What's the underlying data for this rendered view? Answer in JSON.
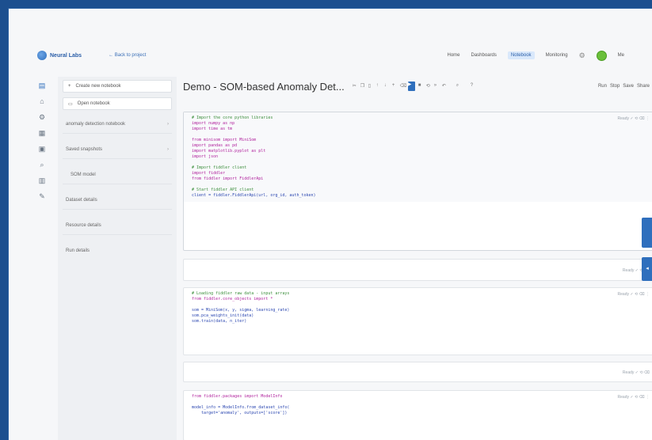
{
  "header": {
    "brand": "Neural Labs",
    "back_link": "← Back to project",
    "nav": [
      "Home",
      "Dashboards",
      "Notebook",
      "Monitoring"
    ],
    "active_nav": "Notebook",
    "settings_icon": "gear-icon",
    "user_initials": "Me"
  },
  "sidebar": {
    "buttons": [
      "Create new notebook",
      "Open notebook"
    ],
    "sections": [
      {
        "label": "anomaly detection notebook",
        "chevron": "›"
      },
      {
        "label": "Saved snapshots",
        "chevron": "›"
      },
      {
        "label": "SOM model",
        "chevron": ""
      },
      {
        "label": "Dataset details",
        "chevron": ""
      },
      {
        "label": "Resource details",
        "chevron": ""
      },
      {
        "label": "Run details",
        "chevron": ""
      }
    ]
  },
  "notebook": {
    "title": "Demo - SOM-based Anomaly Det...",
    "toolbar_right": [
      "Run",
      "Stop",
      "Save",
      "Share"
    ]
  },
  "cells": [
    {
      "meta": "Ready ✓ ⟲ ⌫ ⋮",
      "lines": [
        {
          "t": "cm",
          "v": "# Import the core python libraries"
        },
        {
          "t": "kw",
          "v": "import numpy as np"
        },
        {
          "t": "kw",
          "v": "import time as tm"
        },
        {
          "t": "gap",
          "v": ""
        },
        {
          "t": "kw",
          "v": "from minisom import MiniSom"
        },
        {
          "t": "kw",
          "v": "import pandas as pd"
        },
        {
          "t": "kw",
          "v": "import matplotlib.pyplot as plt"
        },
        {
          "t": "kw",
          "v": "import json"
        },
        {
          "t": "gap",
          "v": ""
        },
        {
          "t": "cm",
          "v": "# Import fiddler client"
        },
        {
          "t": "kw",
          "v": "import fiddler"
        },
        {
          "t": "kw",
          "v": "from fiddler import FiddlerApi"
        },
        {
          "t": "gap",
          "v": ""
        },
        {
          "t": "cm",
          "v": "# Start fiddler API client"
        },
        {
          "t": "str",
          "v": "client = fiddler.FiddlerApi(url, org_id, auth_token)"
        }
      ]
    },
    {
      "meta": "Ready ✓ ⟲ ⌫",
      "lines": []
    },
    {
      "meta": "Ready ✓ ⟲ ⌫ ⋮",
      "lines": [
        {
          "t": "cm",
          "v": "# Loading fiddler raw data - input arrays"
        },
        {
          "t": "kw",
          "v": "from fiddler.core_objects import *"
        },
        {
          "t": "gap",
          "v": ""
        },
        {
          "t": "str",
          "v": "som = MiniSom(x, y, sigma, learning_rate)"
        },
        {
          "t": "str",
          "v": "som.pca_weights_init(data)"
        },
        {
          "t": "str",
          "v": "som.train(data, n_iter)"
        }
      ]
    },
    {
      "meta": "Ready ✓ ⟲ ⌫",
      "lines": []
    },
    {
      "meta": "Ready ✓ ⟲ ⌫ ⋮",
      "lines": [
        {
          "t": "kw",
          "v": "from fiddler.packages import ModelInfo"
        },
        {
          "t": "gap",
          "v": ""
        },
        {
          "t": "str",
          "v": "model_info = ModelInfo.from_dataset_info("
        },
        {
          "t": "str",
          "v": "    target='anomaly', outputs=['score'])"
        }
      ]
    }
  ]
}
